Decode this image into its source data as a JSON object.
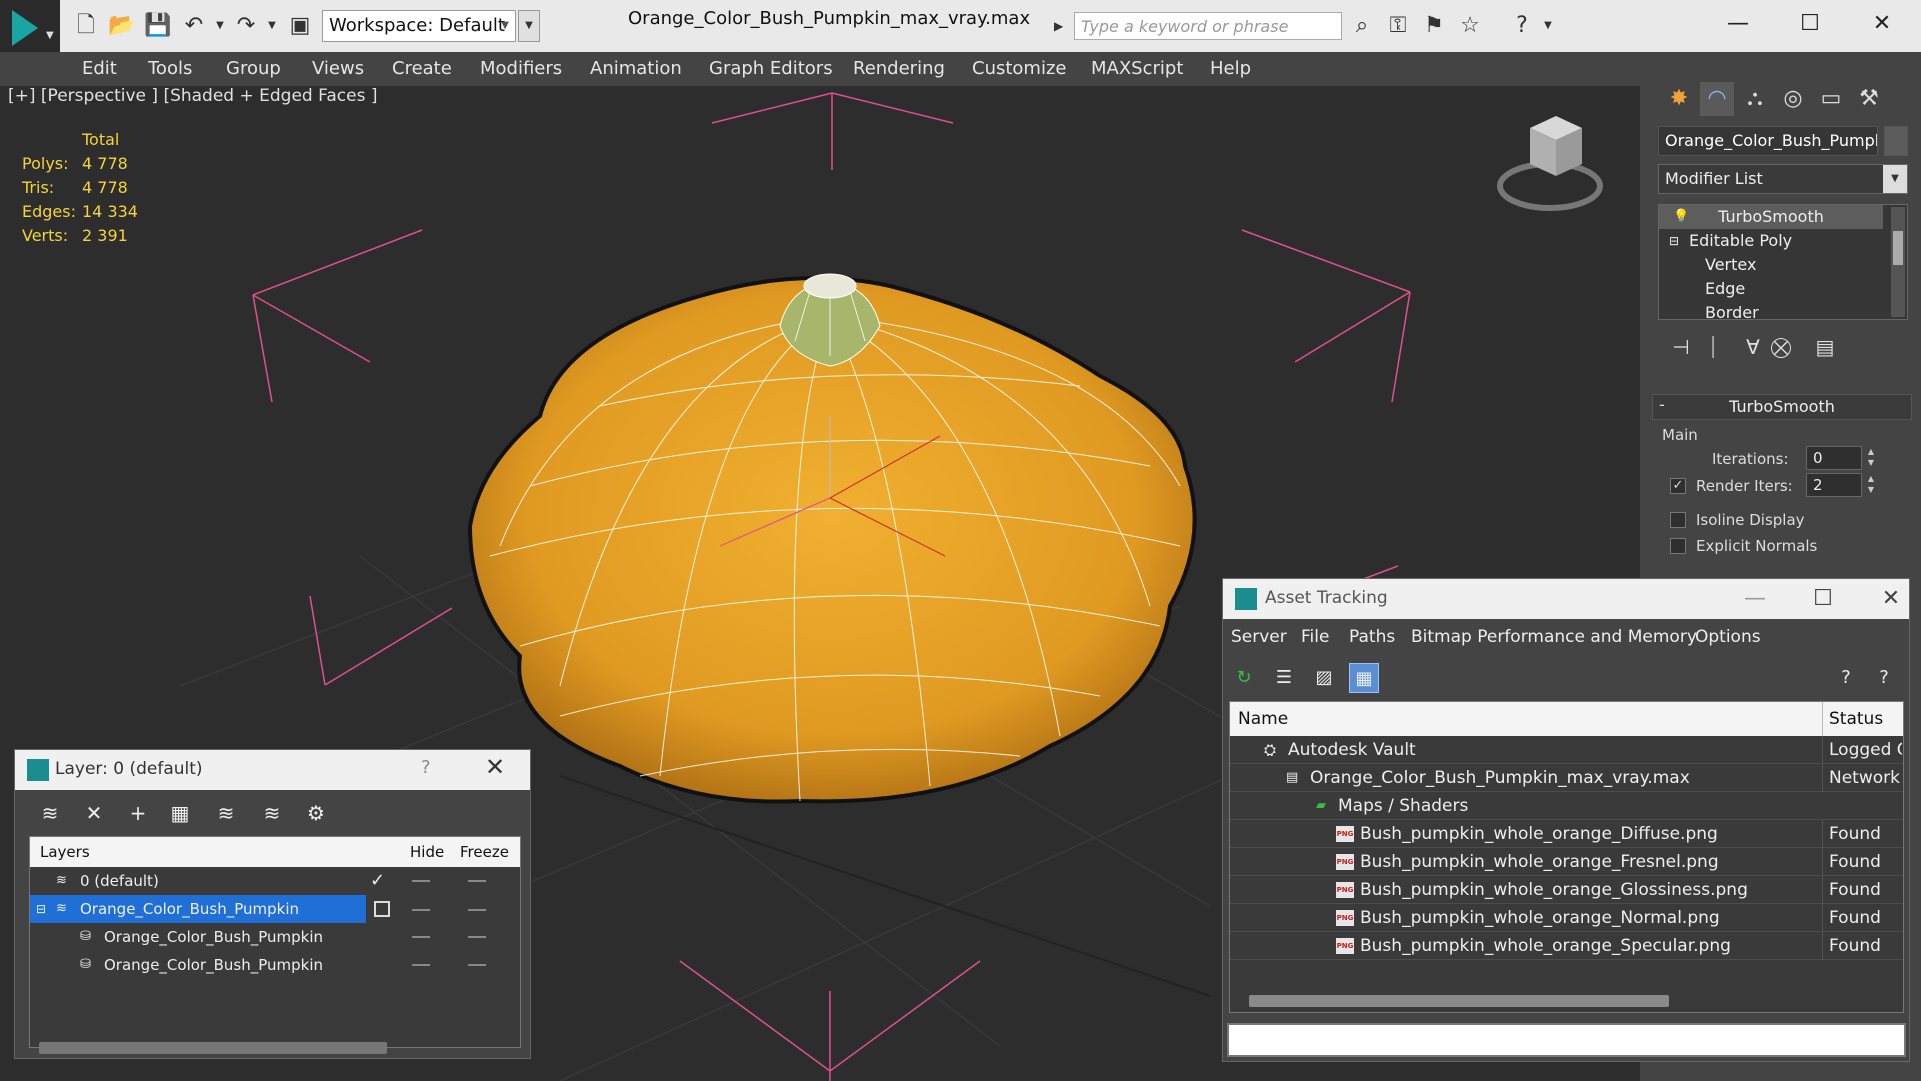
{
  "app": {
    "title": "Orange_Color_Bush_Pumpkin_max_vray.max",
    "workspace": "Workspace: Default",
    "search_placeholder": "Type a keyword or phrase"
  },
  "menu": [
    "Edit",
    "Tools",
    "Group",
    "Views",
    "Create",
    "Modifiers",
    "Animation",
    "Graph Editors",
    "Rendering",
    "Customize",
    "MAXScript",
    "Help"
  ],
  "viewport": {
    "label": "[+] [Perspective ] [Shaded + Edged Faces ]",
    "stats": {
      "header": "Total",
      "rows": [
        {
          "label": "Polys:",
          "value": "4 778"
        },
        {
          "label": "Tris:",
          "value": "4 778"
        },
        {
          "label": "Edges:",
          "value": "14 334"
        },
        {
          "label": "Verts:",
          "value": "2 391"
        }
      ]
    }
  },
  "command_panel": {
    "object_name": "Orange_Color_Bush_Pumpkin",
    "modifier_list": "Modifier List",
    "stack": [
      "TurboSmooth",
      "Editable Poly",
      "Vertex",
      "Edge",
      "Border"
    ],
    "turbosmooth": {
      "title": "TurboSmooth",
      "collapse": "-",
      "main": "Main",
      "iterations_label": "Iterations:",
      "iterations": "0",
      "render_iters_label": "Render Iters:",
      "render_iters": "2",
      "isoline": "Isoline Display",
      "explicit": "Explicit Normals"
    }
  },
  "layer_dialog": {
    "title": "Layer: 0 (default)",
    "help": "?",
    "columns": [
      "Layers",
      "Hide",
      "Freeze"
    ],
    "rows": [
      {
        "name": "0 (default)"
      },
      {
        "name": "Orange_Color_Bush_Pumpkin"
      },
      {
        "name": "Orange_Color_Bush_Pumpkin"
      },
      {
        "name": "Orange_Color_Bush_Pumpkin"
      }
    ]
  },
  "asset_dialog": {
    "title": "Asset Tracking",
    "menu": [
      "Server",
      "File",
      "Paths",
      "Bitmap Performance and Memory",
      "Options"
    ],
    "columns": [
      "Name",
      "Status"
    ],
    "rows": [
      {
        "name": "Autodesk Vault",
        "status": "Logged Out"
      },
      {
        "name": "Orange_Color_Bush_Pumpkin_max_vray.max",
        "status": "Network"
      },
      {
        "name": "Maps / Shaders",
        "status": ""
      },
      {
        "name": "Bush_pumpkin_whole_orange_Diffuse.png",
        "status": "Found"
      },
      {
        "name": "Bush_pumpkin_whole_orange_Fresnel.png",
        "status": "Found"
      },
      {
        "name": "Bush_pumpkin_whole_orange_Glossiness.png",
        "status": "Found"
      },
      {
        "name": "Bush_pumpkin_whole_orange_Normal.png",
        "status": "Found"
      },
      {
        "name": "Bush_pumpkin_whole_orange_Specular.png",
        "status": "Found"
      }
    ]
  },
  "icons": {
    "png_badge": "PNG",
    "colors": {
      "stats": "#f3d43a",
      "pumpkin": "#e5a126",
      "stem": "#a7b66a",
      "selection": "#1f6fd6",
      "camera_lines": "#e0508a"
    }
  }
}
